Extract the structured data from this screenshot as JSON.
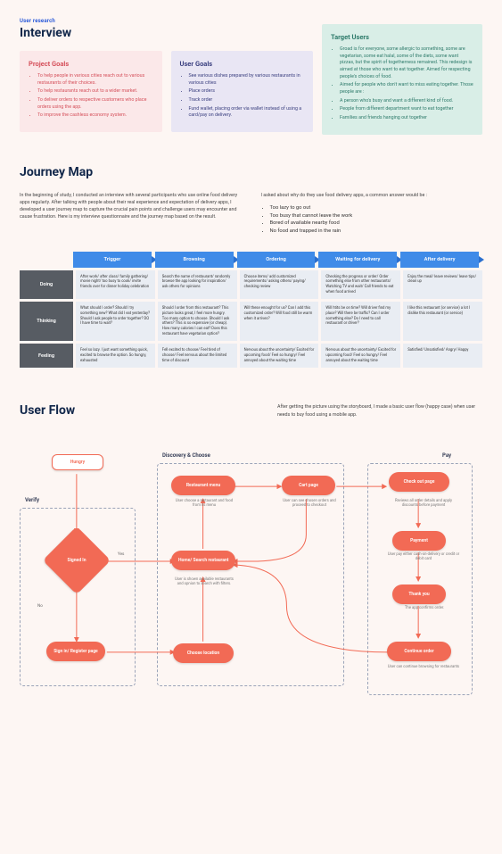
{
  "header": {
    "subtitle": "User research",
    "title": "Interview"
  },
  "goalCards": {
    "project": {
      "title": "Project Goals",
      "items": [
        "To help people in various cities reach out to various restaurants of their choices.",
        "To help restaurants reach out to a wider market.",
        "To deliver orders to respective customers who place orders using the app.",
        "To improve the cashless economy system."
      ]
    },
    "user": {
      "title": "User Goals",
      "items": [
        "See various dishes prepared by various restaurants in various cities",
        "Place orders",
        "Track order",
        "Fund wallet, placing order via wallet instead of using a card/pay on delivery."
      ]
    },
    "target": {
      "title": "Target Users",
      "items": [
        "Groad is for everyone, some allergic to something, some are vegetarian, some eat halal, some of the diets, some want pizzas, but the spirit of togetherness remained. This redesign is aimed at those who want to eat together. Aimed for respecting people's choices of food.",
        "Aimed for people who don't want to miss eating together. Those people are :",
        "A person who's busy and want a different kind of food.",
        "People from different department want to eat together",
        "Families and friends hanging out together"
      ]
    }
  },
  "journey": {
    "title": "Journey Map",
    "intro_left": "In the beginning of study, I conducted an interview with several participants who use online food delivery apps regularly. After talking with people about their real experience and expectation of delivery apps, I developed a user journey map to capture the crucial pain points and challenge users may encounter and cause frustration. Here is my interview questionnaire and the journey map based on the result.",
    "intro_right_lead": "I asked about why do they use food delivery apps, a common answer would be :",
    "intro_right_items": [
      "Too lazy to go out",
      "Too busy that cannot leave the work",
      "Bored of available nearby food",
      "No food and trapped in the rain"
    ],
    "stages": [
      "Trigger",
      "Browsing",
      "Ordering",
      "Waiting for delivery",
      "After delivery"
    ],
    "rows": [
      {
        "label": "Doing",
        "cells": [
          "After work/ after class/ family gathering/ movie night/ too busy to cook/ invite friends over for dinner holiday celebration",
          "Search the name of restaurant/ randomly browse the app looking for inspiration/ ask others for opinions",
          "Choose items/ add customized requirements/ asking others/ paying/ checking review",
          "Checking the progress or order/ Order something else from other restaurants/ Watching TV and wait/ Call friends to eat when food arrived",
          "Enjoy the meal/ leave reviews/ leave tips/ clean up"
        ]
      },
      {
        "label": "Thinking",
        "cells": [
          "What should I order? Should I try something new? What did I eat yesterday? Should I ask people to order together? DO I have time to wait?",
          "Should I order from this restaurant? This picture looks great, I feel more hungry. Too many option to choose. Should I ask others? This is so expensive (or cheap). How many calories I can eat? Does this restaurant have vegetarian option?",
          "Will these enought for us? Can I add this customized order? Will food still be warm when it arrives?",
          "Will htits be on time? Will driver find my place? Will there be traffic? Can I order something else? Do I need to call restaurant or driver?",
          "I like this restaurant (or service) a lot I dislike this restaurant (or service)"
        ]
      },
      {
        "label": "Feeling",
        "cells": [
          "Feel so lazy. I just want something quick, excited to browse the option. So hungry, exhausted",
          "Fell excited to choose/ Feel tired of choose/ Feel nervous about the limited time of discount",
          "Nervous about the uncertainty/ Excited for upcoming food/ Feel so hungry/ Feel annoyed about the waiting time",
          "Nervous about the uncertainty/ Excited for upcoming food/ Feel so hungry/ Feel annoyed about the waiting time",
          "Satisfied/ Unsatisfied/ Angry/ Happy"
        ]
      }
    ]
  },
  "userflow": {
    "title": "User Flow",
    "intro": "After getting the picture using the storyboard, I made a basic user flow (happy case) when user needs to buy food using a mobile app.",
    "groups": {
      "verify": "Verify",
      "discovery": "Discovery & Choose",
      "pay": "Pay"
    },
    "nodes": {
      "hungry": "Hungry",
      "signed_in": "Signed In",
      "signin_register": "Sign in/ Register page",
      "restaurant_menu": "Restaurant menu",
      "home_search": "Home/ Search restaurant",
      "choose_location": "Choose location",
      "cart": "Cart page",
      "checkout": "Check out page",
      "payment": "Payment",
      "thankyou": "Thank you",
      "continue": "Continue order"
    },
    "subs": {
      "restaurant_menu": "User choose a restaurant and food from its menu",
      "home_search": "User is shown available restaurants and opnion to search with filters.",
      "cart": "User can see chosen orders and proceed to checkout",
      "checkout": "Reviews all order details and apply discounts before payment",
      "payment": "User pay either cash-on-delivery or credit or debit card",
      "thankyou": "The app confirms order.",
      "continue": "User can continue browsing for restaurants"
    },
    "edge_labels": {
      "yes": "Yes",
      "no": "No"
    }
  }
}
